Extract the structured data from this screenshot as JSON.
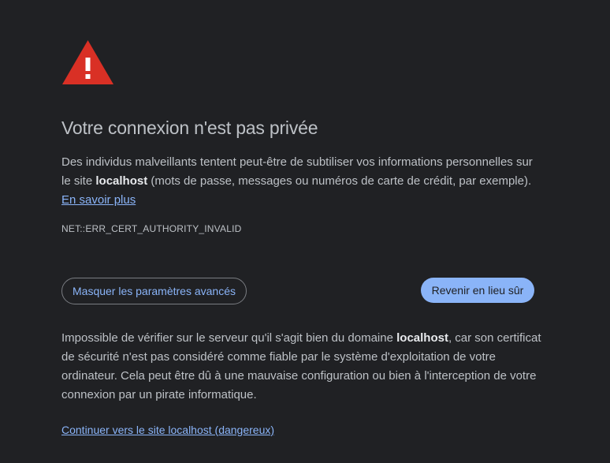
{
  "icon": {
    "name": "warning-triangle-icon",
    "color": "#d93025"
  },
  "title": "Votre connexion n'est pas privée",
  "description": {
    "part1": "Des individus malveillants tentent peut-être de subtiliser vos informations personnelles sur le site ",
    "host": "localhost",
    "part2": " (mots de passe, messages ou numéros de carte de crédit, par exemple). ",
    "learn_more": "En savoir plus"
  },
  "error_code": "NET::ERR_CERT_AUTHORITY_INVALID",
  "buttons": {
    "hide_advanced": "Masquer les paramètres avancés",
    "back_to_safety": "Revenir en lieu sûr"
  },
  "details": {
    "part1": "Impossible de vérifier sur le serveur qu'il s'agit bien du domaine ",
    "host": "localhost",
    "part2": ", car son certificat de sécurité n'est pas considéré comme fiable par le système d'exploitation de votre ordinateur. Cela peut être dû à une mauvaise configuration ou bien à l'interception de votre connexion par un pirate informatique."
  },
  "proceed_link": "Continuer vers le site localhost (dangereux)",
  "colors": {
    "background": "#202124",
    "text": "#bdc1c6",
    "link": "#8ab4f8",
    "danger": "#d93025"
  }
}
